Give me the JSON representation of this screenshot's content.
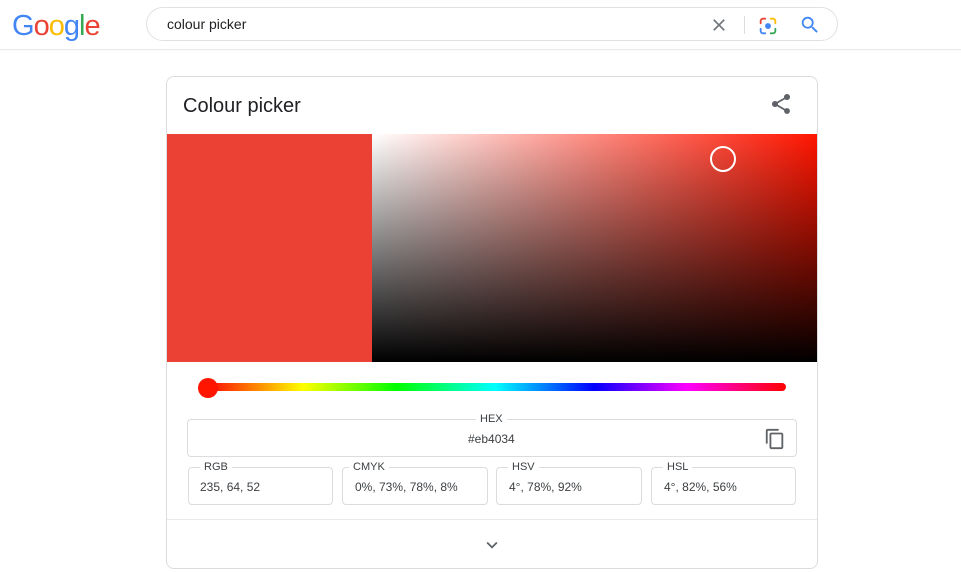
{
  "logo": {
    "letters": [
      "G",
      "o",
      "o",
      "g",
      "l",
      "e"
    ],
    "colors": [
      "#4285f4",
      "#ea4335",
      "#fbbc05",
      "#4285f4",
      "#34a853",
      "#ea4335"
    ]
  },
  "search": {
    "query": "colour picker"
  },
  "icons": {
    "clear": "close-icon",
    "lens": "camera-lens-icon",
    "search": "search-icon",
    "share": "share-icon",
    "copy": "copy-icon",
    "expand": "chevron-down-icon"
  },
  "colour_picker": {
    "title": "Colour picker",
    "selected_color": "#eb4034",
    "hue_color": "#ff1500",
    "hue_level_percent": 0,
    "hex": {
      "label": "HEX",
      "value": "#eb4034"
    },
    "rgb": {
      "label": "RGB",
      "value": "235, 64, 52"
    },
    "cmyk": {
      "label": "CMYK",
      "value": "0%, 73%, 78%, 8%"
    },
    "hsv": {
      "label": "HSV",
      "value": "4°, 78%, 92%"
    },
    "hsl": {
      "label": "HSL",
      "value": "4°, 82%, 56%"
    }
  },
  "colors": {
    "text": "#202124",
    "border": "#dadce0",
    "icon": "#5f6368",
    "accent_blue": "#4285f4"
  }
}
